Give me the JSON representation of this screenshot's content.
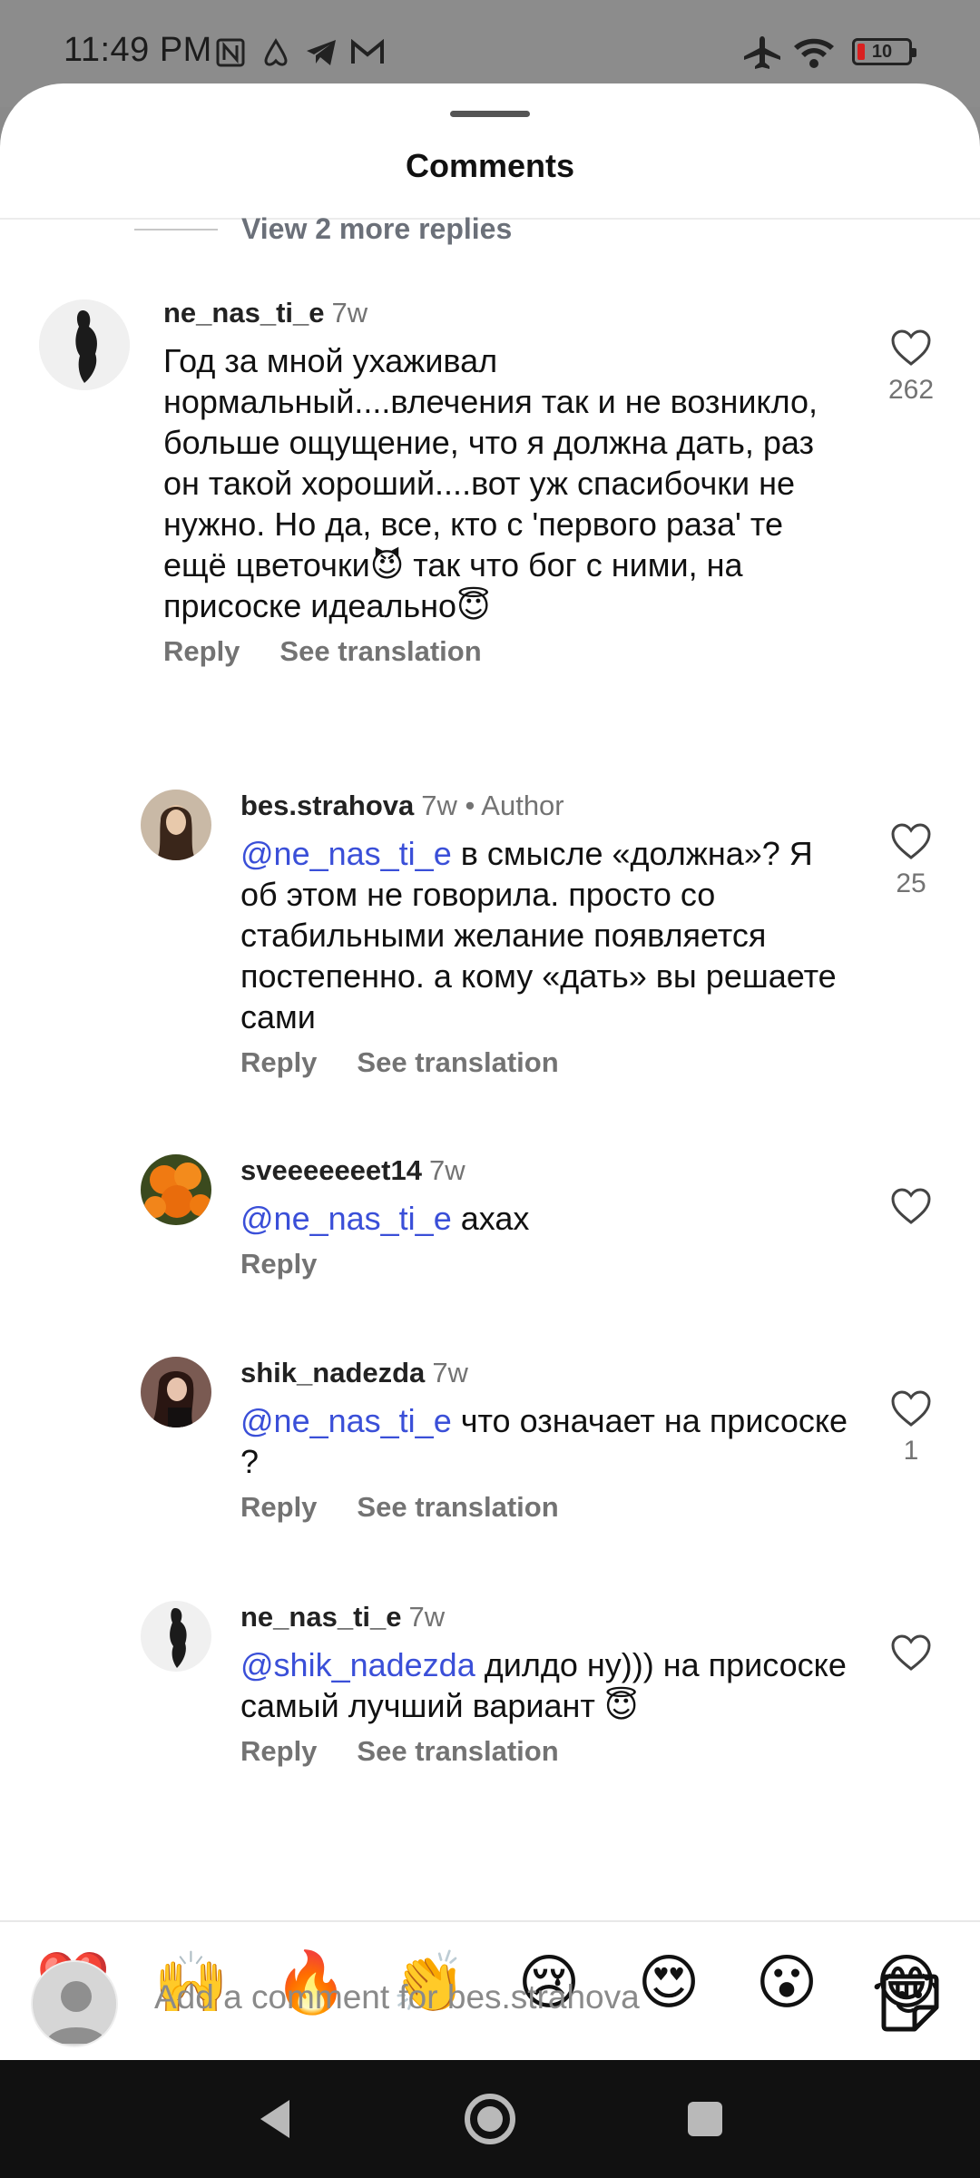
{
  "status_bar": {
    "time": "11:49 PM",
    "battery": "10",
    "icons": [
      "nfc-icon",
      "airbnb-icon",
      "telegram-icon",
      "gmail-icon",
      "airplane-mode-icon",
      "wifi-icon",
      "battery-icon"
    ]
  },
  "sheet": {
    "title": "Comments",
    "view_more_replies": "View 2 more replies"
  },
  "comments": [
    {
      "user": "ne_nas_ti_e",
      "time": "7w",
      "author_tag": "",
      "mention": "",
      "text": "Год за мной ухаживал нормальный....влечения так и не возникло, больше ощущение, что я должна дать, раз он такой хороший....вот уж спасибочки не нужно. Но да, все, кто с 'первого раза' те ещё цветочки😈 так что бог с ними, на присоске идеально😇",
      "reply_label": "Reply",
      "translate_label": "See translation",
      "likes": "262"
    },
    {
      "user": "bes.strahova",
      "time": "7w",
      "author_tag": "• Author",
      "mention": "@ne_nas_ti_e",
      "text": " в смысле «должна»? Я об этом не говорила. просто со стабильными желание появляется постепенно. а кому «дать» вы решаете сами",
      "reply_label": "Reply",
      "translate_label": "See translation",
      "likes": "25"
    },
    {
      "user": "sveeeeeeet14",
      "time": "7w",
      "author_tag": "",
      "mention": "@ne_nas_ti_e",
      "text": " ахах",
      "reply_label": "Reply",
      "translate_label": "",
      "likes": ""
    },
    {
      "user": "shik_nadezda",
      "time": "7w",
      "author_tag": "",
      "mention": "@ne_nas_ti_e",
      "text": " что означает на присоске ?",
      "reply_label": "Reply",
      "translate_label": "See translation",
      "likes": "1"
    },
    {
      "user": "ne_nas_ti_e",
      "time": "7w",
      "author_tag": "",
      "mention": "@shik_nadezda",
      "text": " дилдо ну))) на присоске самый лучший вариант 😇",
      "reply_label": "Reply",
      "translate_label": "See translation",
      "likes": ""
    }
  ],
  "reactions": [
    "❤️",
    "🙌",
    "🔥",
    "👏",
    "😢",
    "😍",
    "😮",
    "😂"
  ],
  "composer": {
    "placeholder": "Add a comment for bes.strahova"
  },
  "colors": {
    "mention": "#3a4fd8",
    "muted": "#737373",
    "battery_low": "#d92020"
  }
}
